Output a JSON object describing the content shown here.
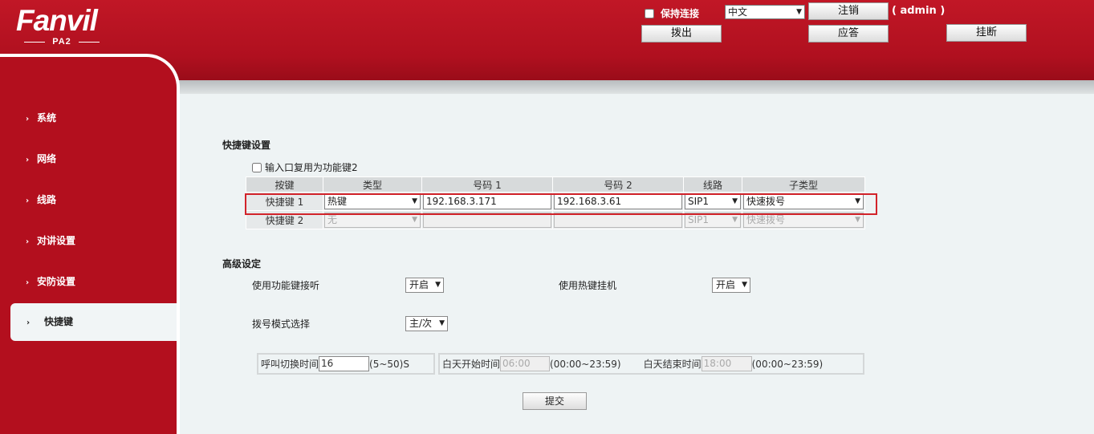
{
  "header": {
    "logo_name": "Fanvil",
    "logo_model": "PA2",
    "keep_online_label": "保持连接",
    "language": "中文",
    "logout_label": "注销",
    "user": "( admin )",
    "dial_out_label": "拨出",
    "answer_label": "应答",
    "hangup_label": "挂断"
  },
  "sidebar": {
    "items": [
      {
        "label": "系统"
      },
      {
        "label": "网络"
      },
      {
        "label": "线路"
      },
      {
        "label": "对讲设置"
      },
      {
        "label": "安防设置"
      },
      {
        "label": "快捷键",
        "active": true
      }
    ]
  },
  "hotkeys": {
    "title": "快捷键设置",
    "input_reuse_label": "输入口复用为功能键2",
    "columns": [
      "按键",
      "类型",
      "号码 1",
      "号码 2",
      "线路",
      "子类型"
    ],
    "rows": [
      {
        "key": "快捷键 1",
        "type": "热键",
        "number1": "192.168.3.171",
        "number2": "192.168.3.61",
        "line": "SIP1",
        "subtype": "快速拨号",
        "enabled": true
      },
      {
        "key": "快捷键 2",
        "type": "无",
        "number1": "",
        "number2": "",
        "line": "SIP1",
        "subtype": "快速拨号",
        "enabled": false
      }
    ]
  },
  "advanced": {
    "title": "高级设定",
    "use_fn_answer_label": "使用功能键接听",
    "use_fn_answer_value": "开启",
    "use_hotkey_hangup_label": "使用热键挂机",
    "use_hotkey_hangup_value": "开启",
    "dial_mode_label": "拨号模式选择",
    "dial_mode_value": "主/次",
    "call_switch_label": "呼叫切换时间",
    "call_switch_value": "16",
    "call_switch_range": "(5~50)S",
    "day_start_label": "白天开始时间",
    "day_start_value": "06:00",
    "day_start_range": "(00:00~23:59)",
    "day_end_label": "白天结束时间",
    "day_end_value": "18:00",
    "day_end_range": "(00:00~23:59)",
    "submit_label": "提交"
  }
}
